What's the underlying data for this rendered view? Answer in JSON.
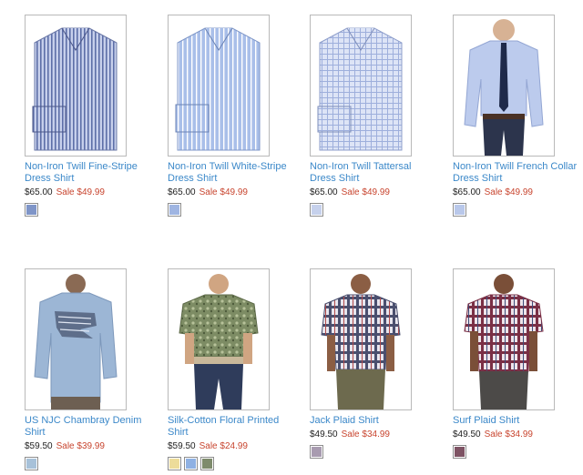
{
  "products": [
    {
      "name": "Non-Iron Twill Fine-Stripe Dress Shirt",
      "price": "$65.00",
      "sale": "Sale $49.99",
      "swatches": [
        "#7f95c8"
      ]
    },
    {
      "name": "Non-Iron Twill White-Stripe Dress Shirt",
      "price": "$65.00",
      "sale": "Sale $49.99",
      "swatches": [
        "#9fb5e2"
      ]
    },
    {
      "name": "Non-Iron Twill Tattersal Dress Shirt",
      "price": "$65.00",
      "sale": "Sale $49.99",
      "swatches": [
        "#c6d1ec"
      ]
    },
    {
      "name": "Non-Iron Twill French Collar Dress Shirt",
      "price": "$65.00",
      "sale": "Sale $49.99",
      "swatches": [
        "#b9c8ea"
      ]
    },
    {
      "name": "US NJC Chambray Denim Shirt",
      "price": "$59.50",
      "sale": "Sale $39.99",
      "swatches": [
        "#a7c1d9"
      ]
    },
    {
      "name": "Silk-Cotton Floral Printed Shirt",
      "price": "$59.50",
      "sale": "Sale $24.99",
      "swatches": [
        "#eddc9a",
        "#8fb1e3",
        "#7e8b6c"
      ]
    },
    {
      "name": "Jack Plaid Shirt",
      "price": "$49.50",
      "sale": "Sale $34.99",
      "swatches": [
        "#a89bb0"
      ]
    },
    {
      "name": "Surf Plaid Shirt",
      "price": "$49.50",
      "sale": "Sale $34.99",
      "swatches": [
        "#7e5364"
      ]
    }
  ]
}
